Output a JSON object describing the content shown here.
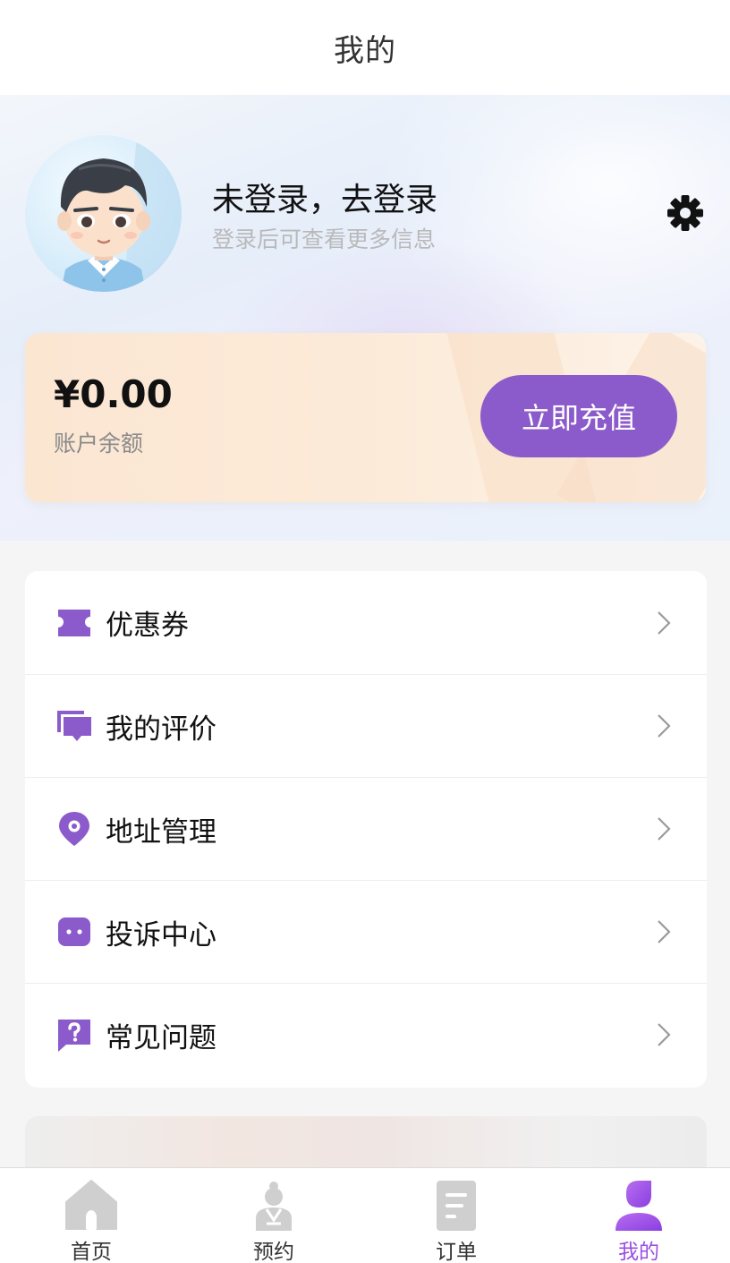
{
  "header": {
    "title": "我的"
  },
  "profile": {
    "login_title": "未登录，去登录",
    "login_subtitle": "登录后可查看更多信息",
    "avatar_icon": "default-user-avatar",
    "settings_icon": "gear-icon"
  },
  "balance": {
    "amount": "¥0.00",
    "label": "账户余额",
    "recharge_label": "立即充值"
  },
  "menu": {
    "items": [
      {
        "label": "优惠券",
        "icon": "coupon-icon"
      },
      {
        "label": "我的评价",
        "icon": "comment-icon"
      },
      {
        "label": "地址管理",
        "icon": "location-pin-icon"
      },
      {
        "label": "投诉中心",
        "icon": "complaint-icon"
      },
      {
        "label": "常见问题",
        "icon": "question-icon"
      }
    ]
  },
  "tabbar": {
    "items": [
      {
        "label": "首页",
        "icon": "home-icon",
        "active": false
      },
      {
        "label": "预约",
        "icon": "appointment-icon",
        "active": false
      },
      {
        "label": "订单",
        "icon": "order-icon",
        "active": false
      },
      {
        "label": "我的",
        "icon": "user-icon",
        "active": true
      }
    ]
  },
  "colors": {
    "accent": "#8c5bcb",
    "active_tab": "#9b4ee0",
    "card_bg": "#fbe6d2",
    "muted_text": "#b9b9b9"
  }
}
